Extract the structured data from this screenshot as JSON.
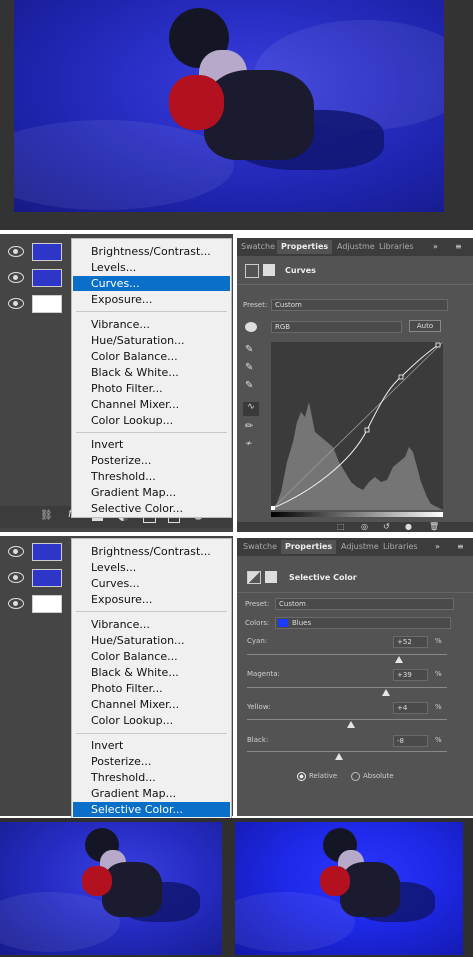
{
  "menu": {
    "items": [
      "Brightness/Contrast...",
      "Levels...",
      "Curves...",
      "Exposure...",
      "Vibrance...",
      "Hue/Saturation...",
      "Color Balance...",
      "Black & White...",
      "Photo Filter...",
      "Channel Mixer...",
      "Color Lookup...",
      "Invert",
      "Posterize...",
      "Threshold...",
      "Gradient Map...",
      "Selective Color..."
    ]
  },
  "curves_panel": {
    "tabs": [
      "Swatche",
      "Properties",
      "Adjustme",
      "Libraries"
    ],
    "title": "Curves",
    "preset_label": "Preset:",
    "preset_value": "Custom",
    "channel_value": "RGB",
    "auto_label": "Auto"
  },
  "selective_panel": {
    "tabs": [
      "Swatche",
      "Properties",
      "Adjustme",
      "Libraries"
    ],
    "title": "Selective Color",
    "preset_label": "Preset:",
    "preset_value": "Custom",
    "colors_label": "Colors:",
    "colors_value": "Blues",
    "sliders": [
      {
        "label": "Cyan:",
        "value": "+52",
        "unit": "%",
        "level": 0.76
      },
      {
        "label": "Magenta:",
        "value": "+39",
        "unit": "%",
        "level": 0.695
      },
      {
        "label": "Yellow:",
        "value": "+4",
        "unit": "%",
        "level": 0.52
      },
      {
        "label": "Black:",
        "value": "-8",
        "unit": "%",
        "level": 0.46
      }
    ],
    "mode_relative": "Relative",
    "mode_absolute": "Absolute"
  },
  "colors": {
    "accent": "#0a6fc9",
    "photo_blue": "#2a2fc7",
    "panel": "#535353"
  }
}
